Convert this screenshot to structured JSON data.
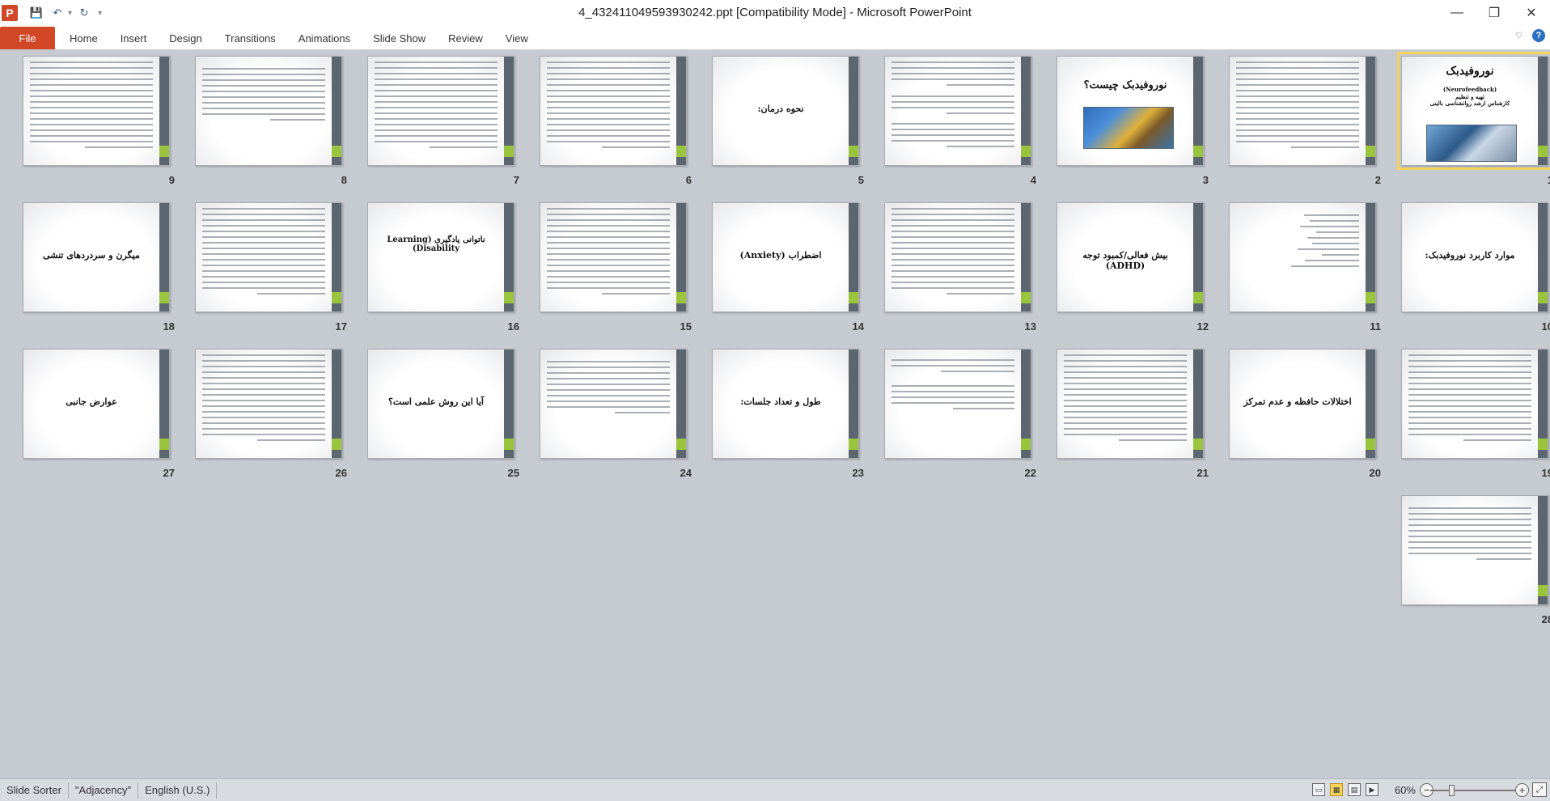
{
  "window": {
    "title": "4_432411049593930242.ppt [Compatibility Mode]  -  Microsoft PowerPoint",
    "app_icon": "P",
    "controls": {
      "minimize": "—",
      "restore": "❐",
      "close": "✕"
    }
  },
  "qat": {
    "save_icon": "💾",
    "undo_icon": "↶",
    "redo_icon": "↻",
    "more_icon": "▾"
  },
  "ribbon": {
    "file_tab": "File",
    "tabs": [
      "Home",
      "Insert",
      "Design",
      "Transitions",
      "Animations",
      "Slide Show",
      "Review",
      "View"
    ],
    "help_glyph": "?",
    "minimize_glyph": "♡"
  },
  "slides": [
    {
      "num": "1",
      "title": "نوروفیدبک",
      "sub1": "(Neurofeedback)",
      "sub2": "تهیه و تنظیم",
      "sub3": "کارشناس ارشد روانشناسی بالینی"
    },
    {
      "num": "2"
    },
    {
      "num": "3",
      "title": "نوروفیدبک چیست؟"
    },
    {
      "num": "4"
    },
    {
      "num": "5",
      "title": "نحوه درمان:"
    },
    {
      "num": "6"
    },
    {
      "num": "7"
    },
    {
      "num": "8"
    },
    {
      "num": "9"
    },
    {
      "num": "10",
      "title": "موارد کاربرد نوروفیدبک:"
    },
    {
      "num": "11"
    },
    {
      "num": "12",
      "title": "بیش فعالی/کمبود توجه (ADHD)"
    },
    {
      "num": "13"
    },
    {
      "num": "14",
      "title": "اضطراب (Anxiety)"
    },
    {
      "num": "15"
    },
    {
      "num": "16",
      "title": "ناتوانی یادگیری (Learning Disability)"
    },
    {
      "num": "17"
    },
    {
      "num": "18",
      "title": "میگرن و سردردهای تنشی"
    },
    {
      "num": "19"
    },
    {
      "num": "20",
      "title": "اختلالات حافظه و عدم تمرکز"
    },
    {
      "num": "21"
    },
    {
      "num": "22"
    },
    {
      "num": "23",
      "title": "طول و تعداد جلسات:"
    },
    {
      "num": "24"
    },
    {
      "num": "25",
      "title": "آیا این روش علمی است؟"
    },
    {
      "num": "26"
    },
    {
      "num": "27",
      "title": "عوارض جانبی"
    },
    {
      "num": "28"
    }
  ],
  "status": {
    "view_label": "Slide Sorter",
    "theme": "\"Adjacency\"",
    "language": "English (U.S.)",
    "zoom": "60%",
    "zoom_value": 0.6
  }
}
